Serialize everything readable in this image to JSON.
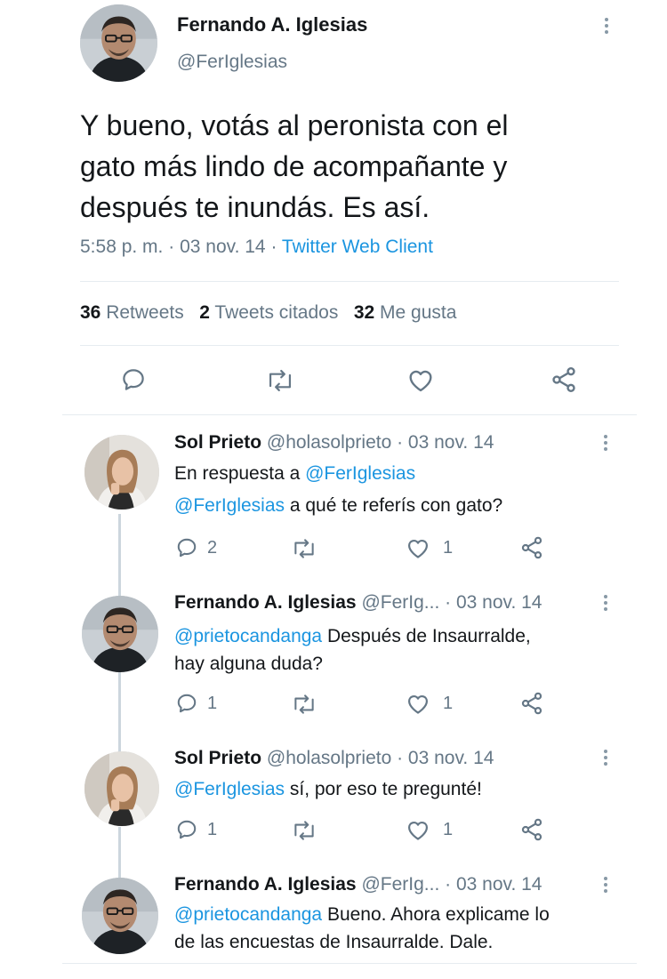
{
  "main_tweet": {
    "author_name": "Fernando A. Iglesias",
    "handle": "@FerIglesias",
    "text_line1": "Y bueno, votás al peronista con el",
    "text_line2": "gato más lindo de acompañante y",
    "text_line3": "después te inundás. Es así.",
    "time": "5:58 p. m.",
    "sep1": "·",
    "date": "03 nov. 14",
    "sep2": "·",
    "client": "Twitter Web Client",
    "retweets_count": "36",
    "retweets_label": "Retweets",
    "quotes_count": "2",
    "quotes_label": "Tweets citados",
    "likes_count": "32",
    "likes_label": "Me gusta"
  },
  "replies": [
    {
      "author_name": "Sol Prieto",
      "handle_date": "@holasolprieto · 03 nov. 14",
      "in_reply_prefix": "En respuesta a ",
      "in_reply_handle": "@FerIglesias",
      "mention": "@FerIglesias",
      "text_line1": " a qué te referís con gato?",
      "reply_count": "2",
      "like_count": "1",
      "avatar": "woman-avatar"
    },
    {
      "author_name": "Fernando A. Iglesias",
      "handle_date": "@FerIg... · 03 nov. 14",
      "mention": "@prietocandanga",
      "text_line1": " Después de Insaurralde,",
      "text_line2": "hay alguna duda?",
      "reply_count": "1",
      "like_count": "1",
      "avatar": "man-avatar"
    },
    {
      "author_name": "Sol Prieto",
      "handle_date": "@holasolprieto · 03 nov. 14",
      "mention": "@FerIglesias",
      "text_line1": " sí, por eso te pregunté!",
      "reply_count": "1",
      "like_count": "1",
      "avatar": "woman-avatar"
    },
    {
      "author_name": "Fernando A. Iglesias",
      "handle_date": "@FerIg... · 03 nov. 14",
      "mention": "@prietocandanga",
      "text_line1": " Bueno. Ahora explicame lo",
      "text_line2": "de las encuestas de Insaurralde. Dale.",
      "avatar": "man-avatar"
    }
  ],
  "colors": {
    "link": "#1b95e0",
    "secondary_text": "#657786",
    "divider": "#e6ecf0",
    "thread_line": "#ccd6dd"
  }
}
